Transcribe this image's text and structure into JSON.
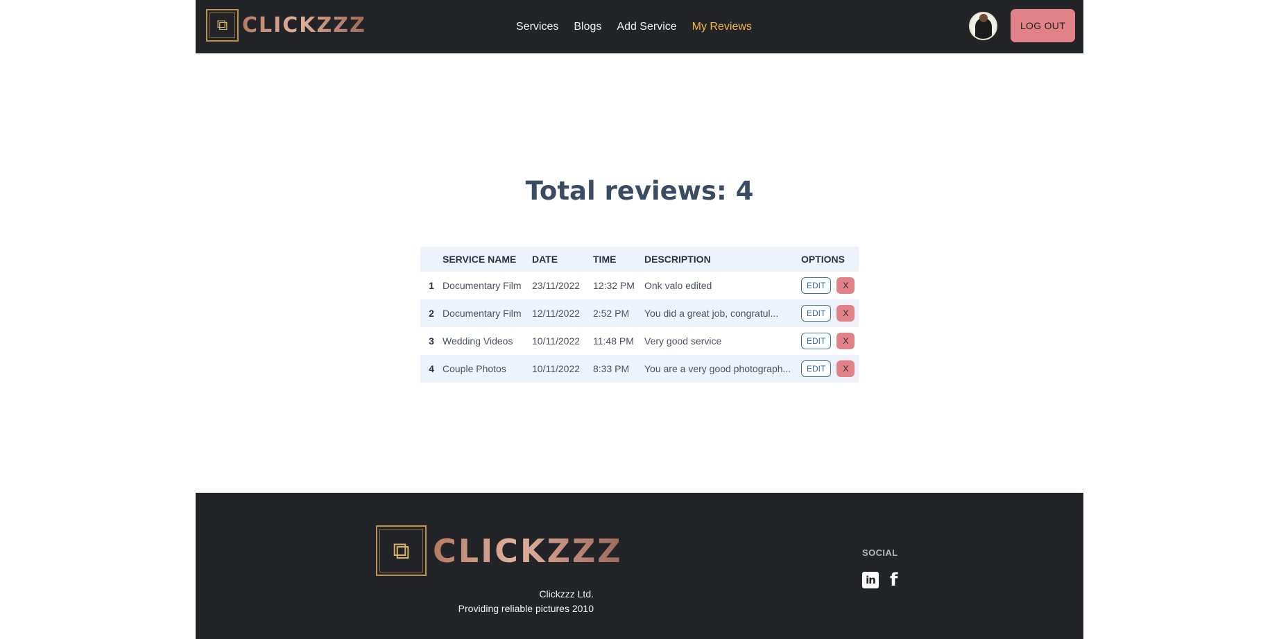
{
  "brand": {
    "name": "CLICKZZZ",
    "logo_icon": "photo-camera-frame-icon"
  },
  "nav": {
    "links": [
      {
        "label": "Services",
        "active": false
      },
      {
        "label": "Blogs",
        "active": false
      },
      {
        "label": "Add Service",
        "active": false
      },
      {
        "label": "My Reviews",
        "active": true
      }
    ],
    "logout_label": "LOG OUT",
    "active_color": "#f2b646"
  },
  "main": {
    "title": "Total reviews: 4",
    "table": {
      "headers": [
        "",
        "SERVICE NAME",
        "DATE",
        "TIME",
        "DESCRIPTION",
        "OPTIONS"
      ],
      "rows": [
        {
          "num": "1",
          "service": "Documentary Film",
          "date": "23/11/2022",
          "time": "12:32 PM",
          "description": "Onk valo edited"
        },
        {
          "num": "2",
          "service": "Documentary Film",
          "date": "12/11/2022",
          "time": "2:52 PM",
          "description": "You did a great job, congratul..."
        },
        {
          "num": "3",
          "service": "Wedding Videos",
          "date": "10/11/2022",
          "time": "11:48 PM",
          "description": "Very good service"
        },
        {
          "num": "4",
          "service": "Couple Photos",
          "date": "10/11/2022",
          "time": "8:33 PM",
          "description": "You are a very good photograph..."
        }
      ],
      "edit_label": "EDIT",
      "delete_label": "X"
    }
  },
  "footer": {
    "company": "Clickzzz Ltd.",
    "tagline": "Providing reliable pictures 2010",
    "social_title": "SOCIAL",
    "social_icons": [
      "linkedin-icon",
      "facebook-icon"
    ],
    "linkedin_glyph": "in",
    "facebook_glyph": "f"
  },
  "colors": {
    "dark_bg": "#232428",
    "logout_bg": "#e08288",
    "table_stripe": "#eef3fb",
    "edit_border": "#3a76a8"
  }
}
